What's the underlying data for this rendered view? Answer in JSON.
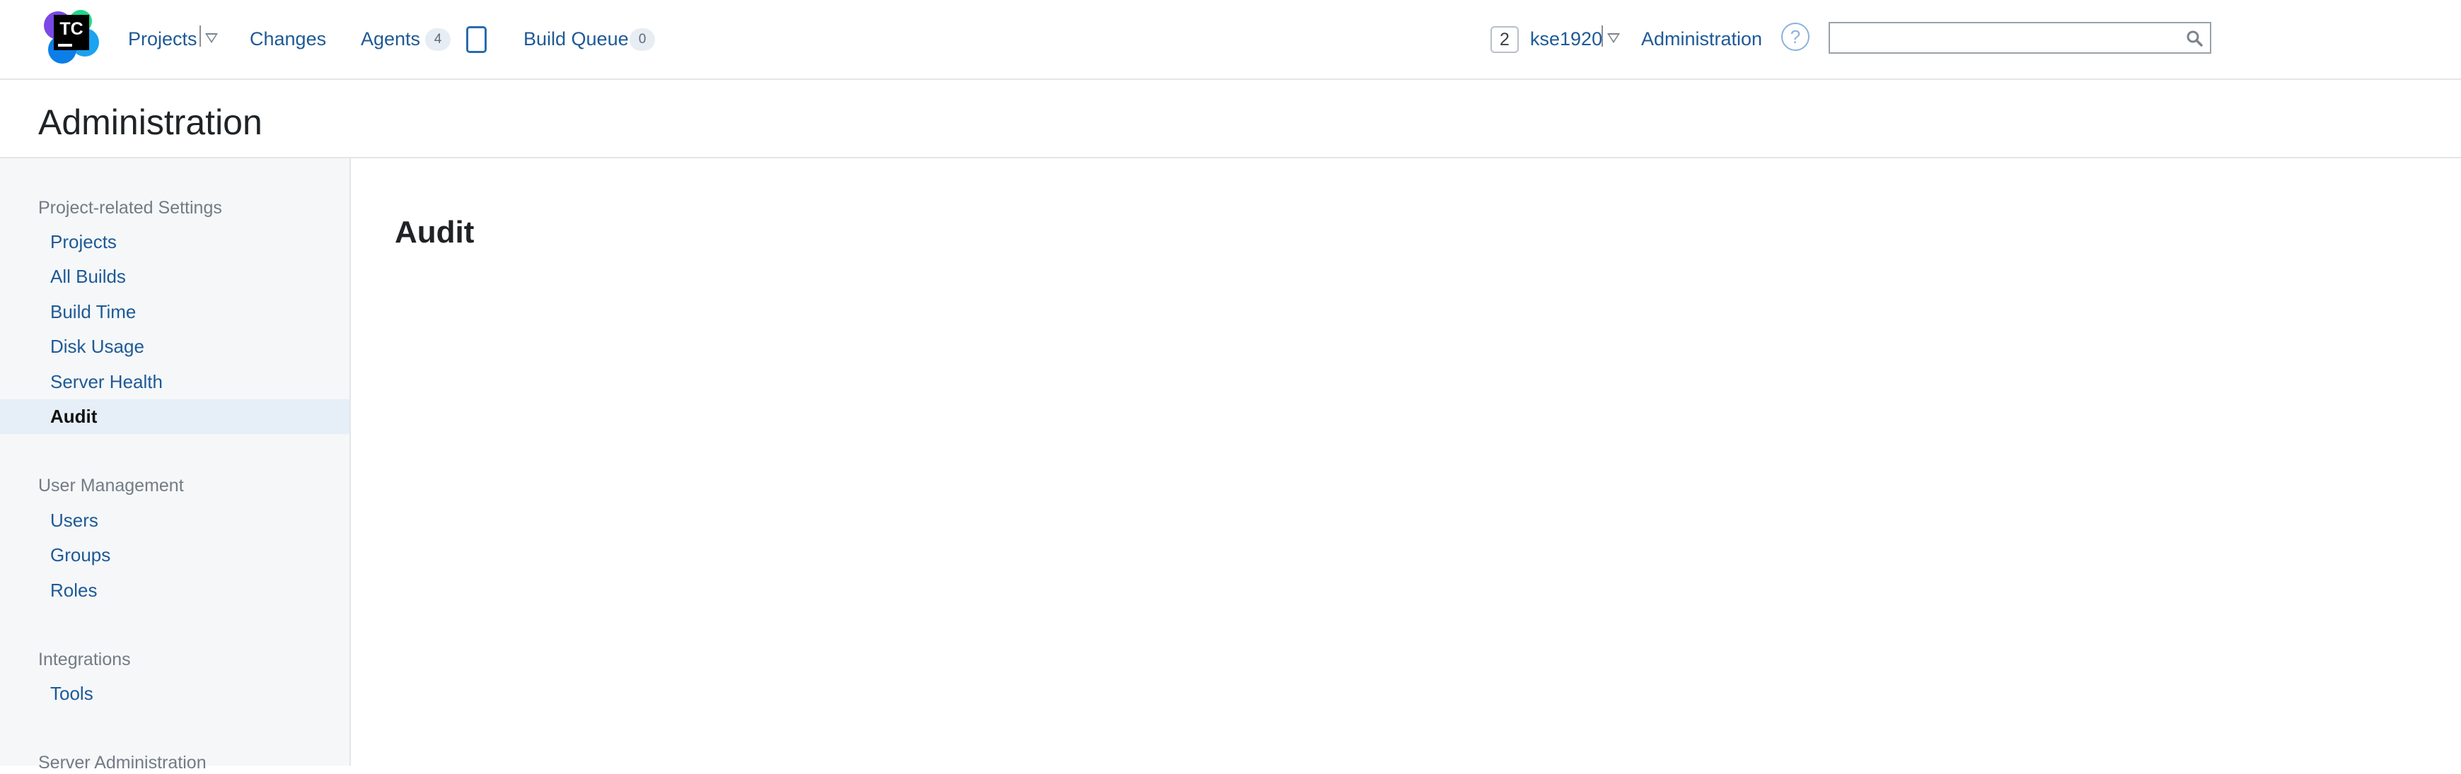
{
  "header": {
    "logo_text": "TC",
    "nav": {
      "projects": "Projects",
      "changes": "Changes",
      "agents": "Agents",
      "agents_count": "4",
      "build_queue": "Build Queue",
      "build_queue_count": "0"
    },
    "notification_count": "2",
    "username": "kse1920",
    "administration": "Administration",
    "help_symbol": "?",
    "search": {
      "value": "",
      "placeholder": ""
    }
  },
  "page": {
    "title": "Administration"
  },
  "sidebar": {
    "sections": [
      {
        "title": "Project-related Settings",
        "items": [
          "Projects",
          "All Builds",
          "Build Time",
          "Disk Usage",
          "Server Health",
          "Audit"
        ]
      },
      {
        "title": "User Management",
        "items": [
          "Users",
          "Groups",
          "Roles"
        ]
      },
      {
        "title": "Integrations",
        "items": [
          "Tools"
        ]
      },
      {
        "title": "Server Administration",
        "items": []
      }
    ],
    "active_item": "Audit"
  },
  "main": {
    "heading": "Audit"
  },
  "colors": {
    "link": "#1e5a96",
    "sidebar_bg": "#f5f7f9",
    "active_bg": "#e6eef8"
  },
  "icons": [
    "teamcity-logo-icon",
    "chevron-down-icon",
    "agent-icon",
    "help-icon",
    "search-icon"
  ]
}
